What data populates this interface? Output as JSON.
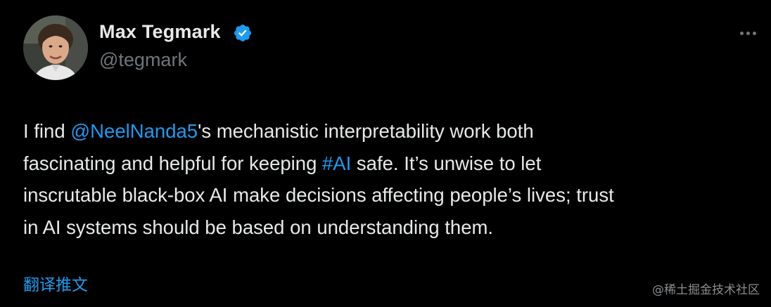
{
  "author": {
    "name": "Max Tegmark",
    "handle": "@tegmark",
    "verified": true,
    "avatar_icon": "user-photo-avatar"
  },
  "tweet": {
    "lines": [
      [
        {
          "text": "I find ",
          "link": false
        },
        {
          "text": "@NeelNanda5",
          "link": true
        },
        {
          "text": "'s mechanistic interpretability work both",
          "link": false
        }
      ],
      [
        {
          "text": "fascinating and helpful for keeping ",
          "link": false
        },
        {
          "text": "#AI",
          "link": true
        },
        {
          "text": " safe. It’s unwise to let",
          "link": false
        }
      ],
      [
        {
          "text": "inscrutable black-box AI make decisions affecting people’s lives; trust",
          "link": false
        }
      ],
      [
        {
          "text": "in AI systems should be based on understanding them.",
          "link": false
        }
      ]
    ]
  },
  "actions": {
    "translate_label": "翻译推文",
    "more_icon": "more-horizontal-icon"
  },
  "watermark": "@稀土掘金技术社区",
  "colors": {
    "background": "#000000",
    "text": "#e7e9ea",
    "muted": "#71767b",
    "accent": "#1d9bf0"
  }
}
